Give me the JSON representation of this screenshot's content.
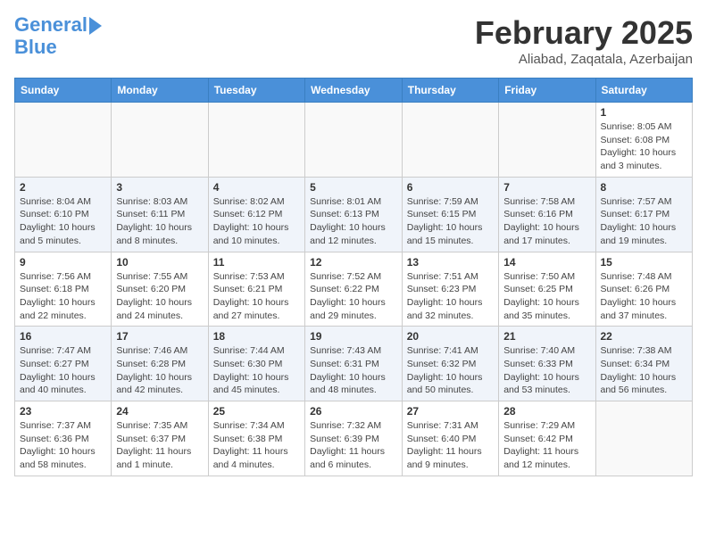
{
  "header": {
    "logo_line1": "General",
    "logo_line2": "Blue",
    "title": "February 2025",
    "location": "Aliabad, Zaqatala, Azerbaijan"
  },
  "weekdays": [
    "Sunday",
    "Monday",
    "Tuesday",
    "Wednesday",
    "Thursday",
    "Friday",
    "Saturday"
  ],
  "weeks": [
    [
      {
        "day": "",
        "info": ""
      },
      {
        "day": "",
        "info": ""
      },
      {
        "day": "",
        "info": ""
      },
      {
        "day": "",
        "info": ""
      },
      {
        "day": "",
        "info": ""
      },
      {
        "day": "",
        "info": ""
      },
      {
        "day": "1",
        "info": "Sunrise: 8:05 AM\nSunset: 6:08 PM\nDaylight: 10 hours\nand 3 minutes."
      }
    ],
    [
      {
        "day": "2",
        "info": "Sunrise: 8:04 AM\nSunset: 6:10 PM\nDaylight: 10 hours\nand 5 minutes."
      },
      {
        "day": "3",
        "info": "Sunrise: 8:03 AM\nSunset: 6:11 PM\nDaylight: 10 hours\nand 8 minutes."
      },
      {
        "day": "4",
        "info": "Sunrise: 8:02 AM\nSunset: 6:12 PM\nDaylight: 10 hours\nand 10 minutes."
      },
      {
        "day": "5",
        "info": "Sunrise: 8:01 AM\nSunset: 6:13 PM\nDaylight: 10 hours\nand 12 minutes."
      },
      {
        "day": "6",
        "info": "Sunrise: 7:59 AM\nSunset: 6:15 PM\nDaylight: 10 hours\nand 15 minutes."
      },
      {
        "day": "7",
        "info": "Sunrise: 7:58 AM\nSunset: 6:16 PM\nDaylight: 10 hours\nand 17 minutes."
      },
      {
        "day": "8",
        "info": "Sunrise: 7:57 AM\nSunset: 6:17 PM\nDaylight: 10 hours\nand 19 minutes."
      }
    ],
    [
      {
        "day": "9",
        "info": "Sunrise: 7:56 AM\nSunset: 6:18 PM\nDaylight: 10 hours\nand 22 minutes."
      },
      {
        "day": "10",
        "info": "Sunrise: 7:55 AM\nSunset: 6:20 PM\nDaylight: 10 hours\nand 24 minutes."
      },
      {
        "day": "11",
        "info": "Sunrise: 7:53 AM\nSunset: 6:21 PM\nDaylight: 10 hours\nand 27 minutes."
      },
      {
        "day": "12",
        "info": "Sunrise: 7:52 AM\nSunset: 6:22 PM\nDaylight: 10 hours\nand 29 minutes."
      },
      {
        "day": "13",
        "info": "Sunrise: 7:51 AM\nSunset: 6:23 PM\nDaylight: 10 hours\nand 32 minutes."
      },
      {
        "day": "14",
        "info": "Sunrise: 7:50 AM\nSunset: 6:25 PM\nDaylight: 10 hours\nand 35 minutes."
      },
      {
        "day": "15",
        "info": "Sunrise: 7:48 AM\nSunset: 6:26 PM\nDaylight: 10 hours\nand 37 minutes."
      }
    ],
    [
      {
        "day": "16",
        "info": "Sunrise: 7:47 AM\nSunset: 6:27 PM\nDaylight: 10 hours\nand 40 minutes."
      },
      {
        "day": "17",
        "info": "Sunrise: 7:46 AM\nSunset: 6:28 PM\nDaylight: 10 hours\nand 42 minutes."
      },
      {
        "day": "18",
        "info": "Sunrise: 7:44 AM\nSunset: 6:30 PM\nDaylight: 10 hours\nand 45 minutes."
      },
      {
        "day": "19",
        "info": "Sunrise: 7:43 AM\nSunset: 6:31 PM\nDaylight: 10 hours\nand 48 minutes."
      },
      {
        "day": "20",
        "info": "Sunrise: 7:41 AM\nSunset: 6:32 PM\nDaylight: 10 hours\nand 50 minutes."
      },
      {
        "day": "21",
        "info": "Sunrise: 7:40 AM\nSunset: 6:33 PM\nDaylight: 10 hours\nand 53 minutes."
      },
      {
        "day": "22",
        "info": "Sunrise: 7:38 AM\nSunset: 6:34 PM\nDaylight: 10 hours\nand 56 minutes."
      }
    ],
    [
      {
        "day": "23",
        "info": "Sunrise: 7:37 AM\nSunset: 6:36 PM\nDaylight: 10 hours\nand 58 minutes."
      },
      {
        "day": "24",
        "info": "Sunrise: 7:35 AM\nSunset: 6:37 PM\nDaylight: 11 hours\nand 1 minute."
      },
      {
        "day": "25",
        "info": "Sunrise: 7:34 AM\nSunset: 6:38 PM\nDaylight: 11 hours\nand 4 minutes."
      },
      {
        "day": "26",
        "info": "Sunrise: 7:32 AM\nSunset: 6:39 PM\nDaylight: 11 hours\nand 6 minutes."
      },
      {
        "day": "27",
        "info": "Sunrise: 7:31 AM\nSunset: 6:40 PM\nDaylight: 11 hours\nand 9 minutes."
      },
      {
        "day": "28",
        "info": "Sunrise: 7:29 AM\nSunset: 6:42 PM\nDaylight: 11 hours\nand 12 minutes."
      },
      {
        "day": "",
        "info": ""
      }
    ]
  ]
}
